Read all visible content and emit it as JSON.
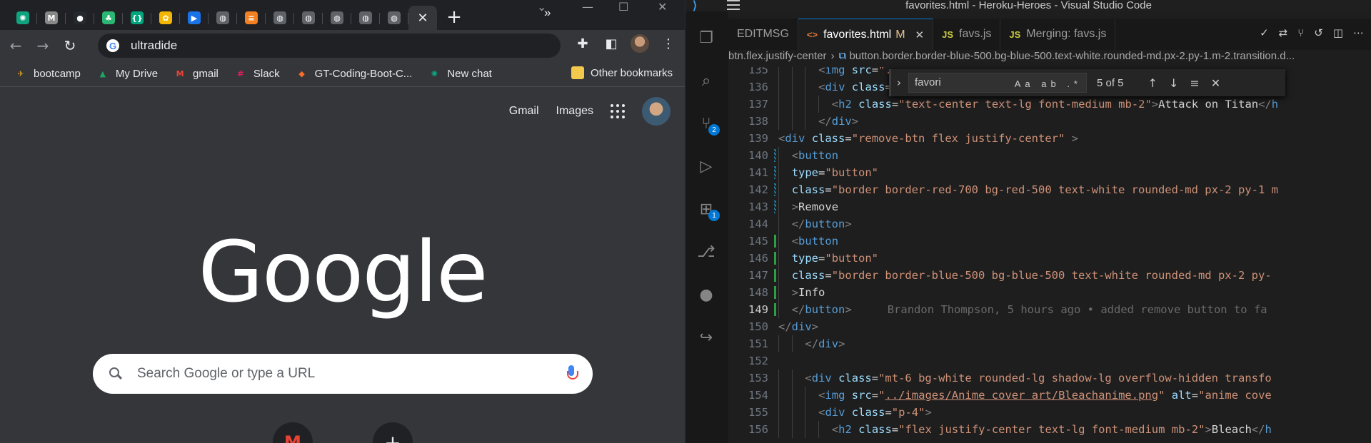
{
  "chrome": {
    "tabs": [
      {
        "icon": "chatgpt-icon",
        "color": "#10a37f",
        "glyph": "✺"
      },
      {
        "icon": "m-logo-icon",
        "color": "#888888",
        "glyph": "M"
      },
      {
        "icon": "github-icon",
        "color": "#24292e",
        "glyph": "●"
      },
      {
        "icon": "leaf-icon",
        "color": "#2bb673",
        "glyph": "♣"
      },
      {
        "icon": "bracket-icon",
        "color": "#00a67e",
        "glyph": "{}"
      },
      {
        "icon": "sun-icon",
        "color": "#f2b705",
        "glyph": "✿"
      },
      {
        "icon": "circle-play-icon",
        "color": "#1a73e8",
        "glyph": "▶"
      },
      {
        "icon": "globe-icon",
        "color": "#5f6368",
        "glyph": "◍"
      },
      {
        "icon": "stackoverflow-icon",
        "color": "#f48024",
        "glyph": "≡"
      },
      {
        "icon": "globe-icon",
        "color": "#5f6368",
        "glyph": "◍"
      },
      {
        "icon": "globe-icon",
        "color": "#5f6368",
        "glyph": "◍"
      },
      {
        "icon": "globe-icon",
        "color": "#5f6368",
        "glyph": "◍"
      },
      {
        "icon": "globe-icon",
        "color": "#5f6368",
        "glyph": "◍"
      },
      {
        "icon": "globe-icon",
        "color": "#5f6368",
        "glyph": "◍"
      }
    ],
    "omnibox": {
      "value": "ultradide"
    },
    "bookmarks": [
      {
        "label": "bootcamp",
        "icon": "bootcamp-icon",
        "color": "#e8a317",
        "glyph": "✈"
      },
      {
        "label": "My Drive",
        "icon": "google-drive-icon",
        "color": "#1fa463",
        "glyph": "▲"
      },
      {
        "label": "gmail",
        "icon": "gmail-icon",
        "color": "#ea4335",
        "glyph": "M"
      },
      {
        "label": "Slack",
        "icon": "slack-icon",
        "color": "#e01e5a",
        "glyph": "#"
      },
      {
        "label": "GT-Coding-Boot-C...",
        "icon": "gitlab-icon",
        "color": "#fc6d26",
        "glyph": "◆"
      },
      {
        "label": "New chat",
        "icon": "chatgpt-icon",
        "color": "#10a37f",
        "glyph": "✺"
      }
    ],
    "bookmarks_more": "»",
    "other_bookmarks": "Other bookmarks",
    "ntp": {
      "gmail": "Gmail",
      "images": "Images",
      "logo": "Google",
      "search_placeholder": "Search Google or type a URL"
    }
  },
  "vscode": {
    "window_title": "favorites.html - Heroku-Heroes - Visual Studio Code",
    "scm_badge": "2",
    "ext_badge": "1",
    "tabs": [
      {
        "label": "EDITMSG",
        "icon": "",
        "modified": "",
        "close": ""
      },
      {
        "label": "favorites.html",
        "icon": "<>",
        "modified": "M",
        "close": "✕"
      },
      {
        "label": "favs.js",
        "icon": "JS",
        "modified": "",
        "close": ""
      },
      {
        "label": "Merging: favs.js",
        "icon": "JS",
        "modified": "",
        "close": ""
      }
    ],
    "breadcrumb": [
      "btn.flex.justify-center",
      "button.border.border-blue-500.bg-blue-500.text-white.rounded-md.px-2.py-1.m-2.transition.d..."
    ],
    "find": {
      "query": "favori",
      "count": "5 of 5",
      "opts": "Aa ab .*"
    },
    "blame": "Brandon Thompson, 5 hours ago • added remove button to fa",
    "current_line": "149",
    "lines": [
      {
        "n": "135",
        "g": "",
        "ind": 3,
        "segs": [
          [
            "pu",
            "<"
          ],
          [
            "tg",
            "img"
          ],
          [
            "tx",
            " "
          ],
          [
            "at",
            "src"
          ],
          [
            "tx",
            "="
          ],
          [
            "st",
            "\".."
          ]
        ]
      },
      {
        "n": "136",
        "g": "",
        "ind": 3,
        "segs": [
          [
            "pu",
            "<"
          ],
          [
            "tg",
            "div"
          ],
          [
            "tx",
            " "
          ],
          [
            "at",
            "class"
          ],
          [
            "tx",
            "="
          ],
          [
            "st",
            "\""
          ]
        ]
      },
      {
        "n": "137",
        "g": "",
        "ind": 4,
        "segs": [
          [
            "pu",
            "<"
          ],
          [
            "tg",
            "h2"
          ],
          [
            "tx",
            " "
          ],
          [
            "at",
            "class"
          ],
          [
            "tx",
            "="
          ],
          [
            "st",
            "\"text-center text-lg font-medium mb-2\""
          ],
          [
            "pu",
            ">"
          ],
          [
            "tx",
            "Attack on Titan"
          ],
          [
            "pu",
            "</"
          ],
          [
            "tg",
            "h"
          ]
        ]
      },
      {
        "n": "138",
        "g": "",
        "ind": 3,
        "segs": [
          [
            "pu",
            "</"
          ],
          [
            "tg",
            "div"
          ],
          [
            "pu",
            ">"
          ]
        ]
      },
      {
        "n": "139",
        "g": "",
        "ind": 0,
        "segs": [
          [
            "pu",
            "<"
          ],
          [
            "tg",
            "div"
          ],
          [
            "tx",
            " "
          ],
          [
            "at",
            "class"
          ],
          [
            "tx",
            "="
          ],
          [
            "st",
            "\"remove-btn flex justify-center\""
          ],
          [
            "tx",
            " "
          ],
          [
            "pu",
            ">"
          ]
        ]
      },
      {
        "n": "140",
        "g": "mod",
        "ind": 1,
        "segs": [
          [
            "pu",
            "<"
          ],
          [
            "tg",
            "button"
          ]
        ]
      },
      {
        "n": "141",
        "g": "mod",
        "ind": 1,
        "segs": [
          [
            "at",
            "type"
          ],
          [
            "tx",
            "="
          ],
          [
            "st",
            "\"button\""
          ]
        ]
      },
      {
        "n": "142",
        "g": "mod",
        "ind": 1,
        "segs": [
          [
            "at",
            "class"
          ],
          [
            "tx",
            "="
          ],
          [
            "st",
            "\"border border-red-700 bg-red-500 text-white rounded-md px-2 py-1 m"
          ]
        ]
      },
      {
        "n": "143",
        "g": "mod",
        "ind": 1,
        "segs": [
          [
            "pu",
            ">"
          ],
          [
            "tx",
            "Remove"
          ]
        ]
      },
      {
        "n": "144",
        "g": "",
        "ind": 1,
        "segs": [
          [
            "pu",
            "</"
          ],
          [
            "tg",
            "button"
          ],
          [
            "pu",
            ">"
          ]
        ]
      },
      {
        "n": "145",
        "g": "add",
        "ind": 1,
        "segs": [
          [
            "pu",
            "<"
          ],
          [
            "tg",
            "button"
          ]
        ]
      },
      {
        "n": "146",
        "g": "add",
        "ind": 1,
        "segs": [
          [
            "at",
            "type"
          ],
          [
            "tx",
            "="
          ],
          [
            "st",
            "\"button\""
          ]
        ]
      },
      {
        "n": "147",
        "g": "add",
        "ind": 1,
        "segs": [
          [
            "at",
            "class"
          ],
          [
            "tx",
            "="
          ],
          [
            "st",
            "\"border border-blue-500 bg-blue-500 text-white rounded-md px-2 py-"
          ]
        ]
      },
      {
        "n": "148",
        "g": "add",
        "ind": 1,
        "segs": [
          [
            "pu",
            ">"
          ],
          [
            "tx",
            "Info"
          ]
        ]
      },
      {
        "n": "149",
        "g": "add",
        "ind": 1,
        "segs": [
          [
            "pu",
            "</"
          ],
          [
            "tg",
            "button"
          ],
          [
            "pu",
            ">"
          ]
        ],
        "blame": true
      },
      {
        "n": "150",
        "g": "",
        "ind": 0,
        "segs": [
          [
            "pu",
            "</"
          ],
          [
            "tg",
            "div"
          ],
          [
            "pu",
            ">"
          ]
        ]
      },
      {
        "n": "151",
        "g": "",
        "ind": 2,
        "segs": [
          [
            "pu",
            "</"
          ],
          [
            "tg",
            "div"
          ],
          [
            "pu",
            ">"
          ]
        ]
      },
      {
        "n": "152",
        "g": "",
        "ind": 0,
        "segs": []
      },
      {
        "n": "153",
        "g": "",
        "ind": 2,
        "segs": [
          [
            "pu",
            "<"
          ],
          [
            "tg",
            "div"
          ],
          [
            "tx",
            " "
          ],
          [
            "at",
            "class"
          ],
          [
            "tx",
            "="
          ],
          [
            "st",
            "\"mt-6 bg-white rounded-lg shadow-lg overflow-hidden transfo"
          ]
        ]
      },
      {
        "n": "154",
        "g": "",
        "ind": 3,
        "segs": [
          [
            "pu",
            "<"
          ],
          [
            "tg",
            "img"
          ],
          [
            "tx",
            " "
          ],
          [
            "at",
            "src"
          ],
          [
            "tx",
            "="
          ],
          [
            "st",
            "\""
          ],
          [
            "st link",
            "../images/Anime cover art/Bleachanime.png"
          ],
          [
            "st",
            "\""
          ],
          [
            "tx",
            " "
          ],
          [
            "at",
            "alt"
          ],
          [
            "tx",
            "="
          ],
          [
            "st",
            "\"anime cove"
          ]
        ]
      },
      {
        "n": "155",
        "g": "",
        "ind": 3,
        "segs": [
          [
            "pu",
            "<"
          ],
          [
            "tg",
            "div"
          ],
          [
            "tx",
            " "
          ],
          [
            "at",
            "class"
          ],
          [
            "tx",
            "="
          ],
          [
            "st",
            "\"p-4\""
          ],
          [
            "pu",
            ">"
          ]
        ]
      },
      {
        "n": "156",
        "g": "",
        "ind": 4,
        "segs": [
          [
            "pu",
            "<"
          ],
          [
            "tg",
            "h2"
          ],
          [
            "tx",
            " "
          ],
          [
            "at",
            "class"
          ],
          [
            "tx",
            "="
          ],
          [
            "st",
            "\"flex justify-center text-lg font-medium mb-2\""
          ],
          [
            "pu",
            ">"
          ],
          [
            "tx",
            "Bleach"
          ],
          [
            "pu",
            "</"
          ],
          [
            "tg",
            "h"
          ]
        ]
      }
    ]
  }
}
